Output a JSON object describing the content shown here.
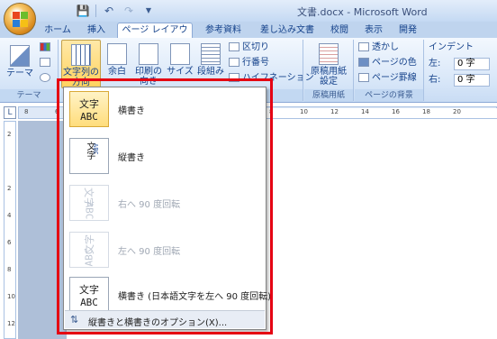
{
  "window": {
    "title": "文書.docx - Microsoft Word"
  },
  "qat": {
    "save_icon": "save-icon",
    "undo_icon": "undo-icon",
    "redo_icon": "redo-icon"
  },
  "tabs": [
    {
      "label": "ホーム"
    },
    {
      "label": "挿入"
    },
    {
      "label": "ページ レイアウト",
      "active": true
    },
    {
      "label": "参考資料"
    },
    {
      "label": "差し込み文書"
    },
    {
      "label": "校閲"
    },
    {
      "label": "表示"
    },
    {
      "label": "開発"
    }
  ],
  "ribbon": {
    "theme_group": {
      "theme_button": "テーマ",
      "label": "テーマ"
    },
    "page_setup": {
      "text_direction_line1": "文字列の",
      "text_direction_line2": "方向",
      "margins": "余白",
      "orientation_line1": "印刷の",
      "orientation_line2": "向き",
      "size": "サイズ",
      "columns": "段組み",
      "breaks": "区切り",
      "line_numbers": "行番号",
      "hyphenation": "ハイフネーション"
    },
    "manuscript": {
      "button_line1": "原稿用紙",
      "button_line2": "設定",
      "label": "原稿用紙"
    },
    "page_background": {
      "watermark": "透かし",
      "page_color": "ページの色",
      "page_borders": "ページ罫線",
      "label": "ページの背景"
    },
    "indent": {
      "label": "インデント",
      "left_label": "左:",
      "left_value": "0 字",
      "right_label": "右:",
      "right_value": "0 字"
    }
  },
  "ruler": {
    "corner": "L",
    "ticks": [
      "8",
      "6",
      "4",
      "2",
      "",
      "2",
      "4",
      "6",
      "8",
      "10",
      "12",
      "14",
      "16",
      "18",
      "20"
    ]
  },
  "vruler": {
    "ticks": [
      "2",
      "",
      "2",
      "4",
      "6",
      "8",
      "10",
      "12"
    ]
  },
  "menu": {
    "items": [
      {
        "label": "横書き",
        "icon_l1": "文字",
        "icon_l2": "ABC",
        "selected": true,
        "disabled": false
      },
      {
        "label": "縦書き",
        "icon_l1": "文字",
        "icon_l2": "ABC",
        "selected": false,
        "disabled": false
      },
      {
        "label": "右へ 90 度回転",
        "icon_l1": "文字",
        "icon_l2": "ABC",
        "selected": false,
        "disabled": true
      },
      {
        "label": "左へ 90 度回転",
        "icon_l1": "文字",
        "icon_l2": "ABC",
        "selected": false,
        "disabled": true
      },
      {
        "label": "横書き (日本語文字を左へ 90 度回転)",
        "icon_l1": "文字",
        "icon_l2": "ABC",
        "selected": false,
        "disabled": false
      }
    ],
    "options_label": "縦書きと横書きのオプション(X)..."
  },
  "colors": {
    "highlight": "#e50012",
    "ribbon": "#d7e6f8",
    "selected_item": "#ffdd7c"
  }
}
